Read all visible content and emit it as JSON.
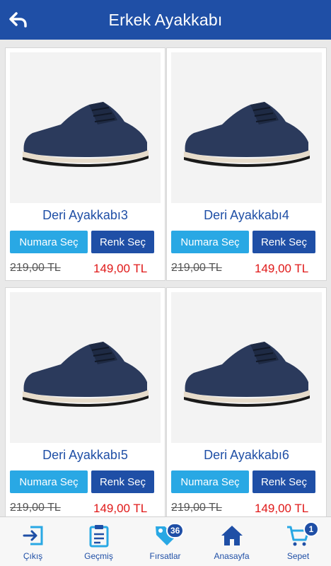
{
  "header": {
    "title": "Erkek Ayakkabı",
    "back_icon": "back-arrow-icon"
  },
  "products": [
    {
      "name": "Deri Ayakkabı3",
      "size_button": "Numara Seç",
      "color_button": "Renk Seç",
      "old_price": "219,00 TL",
      "price": "149,00 TL"
    },
    {
      "name": "Deri Ayakkabı4",
      "size_button": "Numara Seç",
      "color_button": "Renk Seç",
      "old_price": "219,00 TL",
      "price": "149,00 TL"
    },
    {
      "name": "Deri Ayakkabı5",
      "size_button": "Numara Seç",
      "color_button": "Renk Seç",
      "old_price": "219,00 TL",
      "price": "149,00 TL"
    },
    {
      "name": "Deri Ayakkabı6",
      "size_button": "Numara Seç",
      "color_button": "Renk Seç",
      "old_price": "219,00 TL",
      "price": "149,00 TL"
    }
  ],
  "bottom_nav": {
    "items": [
      {
        "label": "Çıkış",
        "icon": "logout-icon"
      },
      {
        "label": "Geçmiş",
        "icon": "clipboard-icon"
      },
      {
        "label": "Fırsatlar",
        "icon": "tag-icon",
        "badge": "36"
      },
      {
        "label": "Anasayfa",
        "icon": "home-icon"
      },
      {
        "label": "Sepet",
        "icon": "cart-icon",
        "badge": "1"
      }
    ]
  },
  "colors": {
    "primary": "#1f4fa6",
    "accent": "#29a8e4",
    "price": "#e01818"
  }
}
